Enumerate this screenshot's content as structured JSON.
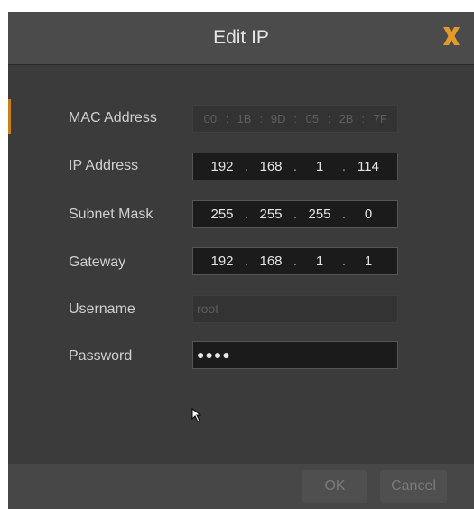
{
  "dialog": {
    "title": "Edit IP",
    "close_icon": "close-x-icon",
    "accent_color": "#e39a2b"
  },
  "form": {
    "mac_address": {
      "label": "MAC Address",
      "segments": [
        "00",
        "1B",
        "9D",
        "05",
        "2B",
        "7F"
      ],
      "disabled": true
    },
    "ip_address": {
      "label": "IP Address",
      "octets": [
        "192",
        "168",
        "1",
        "114"
      ]
    },
    "subnet_mask": {
      "label": "Subnet Mask",
      "octets": [
        "255",
        "255",
        "255",
        "0"
      ]
    },
    "gateway": {
      "label": "Gateway",
      "octets": [
        "192",
        "168",
        "1",
        "1"
      ]
    },
    "username": {
      "label": "Username",
      "value": "root",
      "disabled": true
    },
    "password": {
      "label": "Password",
      "value": "●●●●"
    }
  },
  "footer": {
    "ok_label": "OK",
    "cancel_label": "Cancel"
  },
  "cursor_icon": "mouse-pointer-icon"
}
